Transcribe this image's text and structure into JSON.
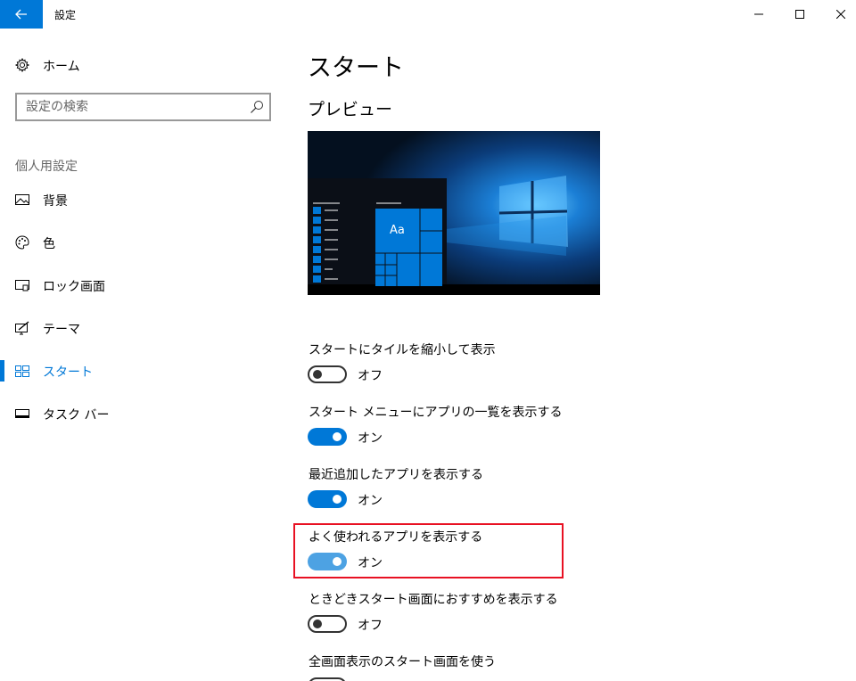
{
  "window": {
    "title": "設定"
  },
  "sidebar": {
    "home_label": "ホーム",
    "search_placeholder": "設定の検索",
    "section_label": "個人用設定",
    "items": [
      {
        "label": "背景",
        "icon": "image-icon"
      },
      {
        "label": "色",
        "icon": "palette-icon"
      },
      {
        "label": "ロック画面",
        "icon": "lock-screen-icon"
      },
      {
        "label": "テーマ",
        "icon": "theme-icon"
      },
      {
        "label": "スタート",
        "icon": "start-icon",
        "active": true
      },
      {
        "label": "タスク バー",
        "icon": "taskbar-icon"
      }
    ]
  },
  "main": {
    "title": "スタート",
    "preview_title": "プレビュー",
    "preview_tile_text": "Aa",
    "settings": [
      {
        "label": "スタートにタイルを縮小して表示",
        "state": "オフ",
        "on": false
      },
      {
        "label": "スタート メニューにアプリの一覧を表示する",
        "state": "オン",
        "on": true
      },
      {
        "label": "最近追加したアプリを表示する",
        "state": "オン",
        "on": true
      },
      {
        "label": "よく使われるアプリを表示する",
        "state": "オン",
        "on": true,
        "highlighted": true
      },
      {
        "label": "ときどきスタート画面におすすめを表示する",
        "state": "オフ",
        "on": false
      },
      {
        "label": "全画面表示のスタート画面を使う"
      }
    ]
  },
  "colors": {
    "accent": "#0078d7",
    "highlight_border": "#e81123"
  }
}
